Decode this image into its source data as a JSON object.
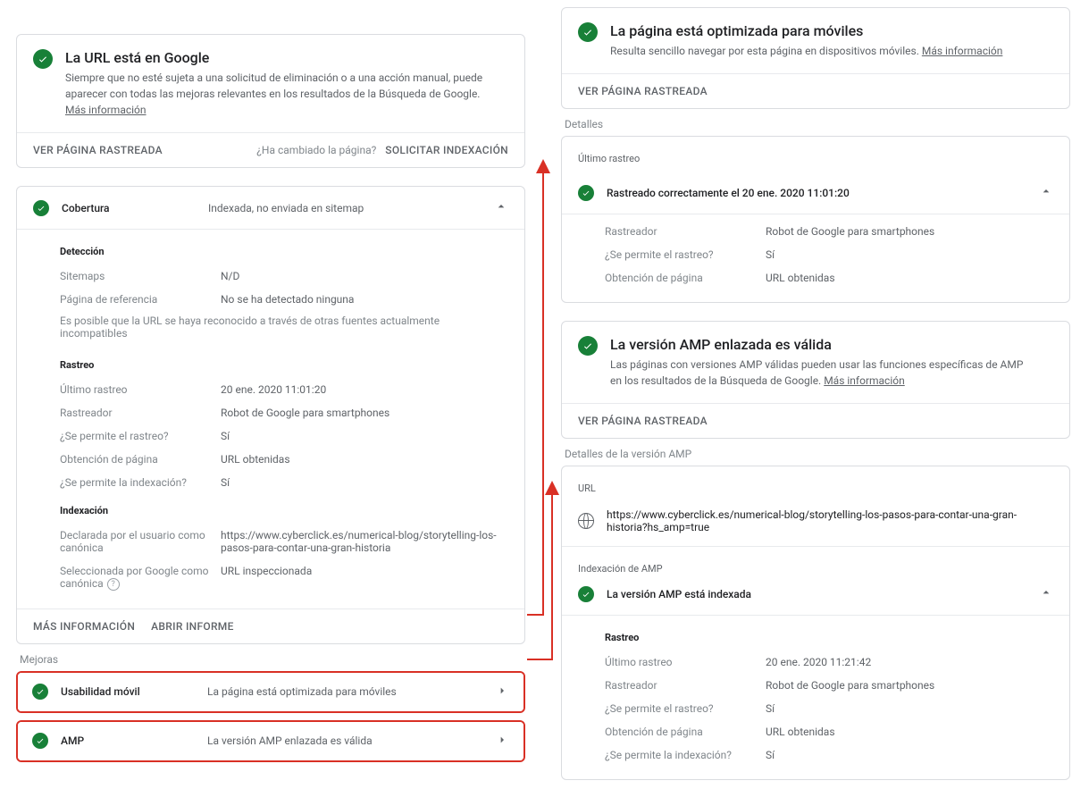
{
  "left": {
    "main": {
      "title": "La URL está en Google",
      "subtitle": "Siempre que no esté sujeta a una solicitud de eliminación o a una acción manual, puede aparecer con todas las mejoras relevantes en los resultados de la Búsqueda de Google.",
      "more_info": "Más información",
      "view_crawled": "VER PÁGINA RASTREADA",
      "changed_q": "¿Ha cambiado la página?",
      "request_index": "SOLICITAR INDEXACIÓN"
    },
    "coverage": {
      "label": "Cobertura",
      "status": "Indexada, no enviada en sitemap",
      "detection_h": "Detección",
      "sitemaps_k": "Sitemaps",
      "sitemaps_v": "N/D",
      "refpage_k": "Página de referencia",
      "refpage_v": "No se ha detectado ninguna",
      "note": "Es posible que la URL se haya reconocido a través de otras fuentes actualmente incompatibles",
      "crawl_h": "Rastreo",
      "lastcrawl_k": "Último rastreo",
      "lastcrawl_v": "20 ene. 2020 11:01:20",
      "crawler_k": "Rastreador",
      "crawler_v": "Robot de Google para smartphones",
      "crawl_allowed_k": "¿Se permite el rastreo?",
      "crawl_allowed_v": "Sí",
      "fetch_k": "Obtención de página",
      "fetch_v": "URL obtenidas",
      "index_allowed_k": "¿Se permite la indexación?",
      "index_allowed_v": "Sí",
      "indexing_h": "Indexación",
      "user_canon_k": "Declarada por el usuario como canónica",
      "user_canon_v": "https://www.cyberclick.es/numerical-blog/storytelling-los-pasos-para-contar-una-gran-historia",
      "google_canon_k": "Seleccionada por Google como canónica",
      "google_canon_v": "URL inspeccionada",
      "more_info": "MÁS INFORMACIÓN",
      "open_report": "ABRIR INFORME"
    },
    "improvements_label": "Mejoras",
    "mobile": {
      "label": "Usabilidad móvil",
      "status": "La página está optimizada para móviles"
    },
    "amp": {
      "label": "AMP",
      "status": "La versión AMP enlazada es válida"
    }
  },
  "right": {
    "mobile": {
      "title": "La página está optimizada para móviles",
      "subtitle": "Resulta sencillo navegar por esta página en dispositivos móviles.",
      "more_info": "Más información",
      "view_crawled": "VER PÁGINA RASTREADA",
      "details_label": "Detalles",
      "lastcrawl_h": "Último rastreo",
      "crawl_status": "Rastreado correctamente el 20 ene. 2020 11:01:20",
      "crawler_k": "Rastreador",
      "crawler_v": "Robot de Google para smartphones",
      "crawl_allowed_k": "¿Se permite el rastreo?",
      "crawl_allowed_v": "Sí",
      "fetch_k": "Obtención de página",
      "fetch_v": "URL obtenidas"
    },
    "amp": {
      "title": "La versión AMP enlazada es válida",
      "subtitle": "Las páginas con versiones AMP válidas pueden usar las funciones específicas de AMP en los resultados de la Búsqueda de Google.",
      "more_info": "Más información",
      "view_crawled": "VER PÁGINA RASTREADA",
      "details_label": "Detalles de la versión AMP",
      "url_h": "URL",
      "url_v": "https://www.cyberclick.es/numerical-blog/storytelling-los-pasos-para-contar-una-gran-historia?hs_amp=true",
      "amp_index_h": "Indexación de AMP",
      "amp_index_status": "La versión AMP está indexada",
      "crawl_h": "Rastreo",
      "lastcrawl_k": "Último rastreo",
      "lastcrawl_v": "20 ene. 2020 11:21:42",
      "crawler_k": "Rastreador",
      "crawler_v": "Robot de Google para smartphones",
      "crawl_allowed_k": "¿Se permite el rastreo?",
      "crawl_allowed_v": "Sí",
      "fetch_k": "Obtención de página",
      "fetch_v": "URL obtenidas",
      "index_allowed_k": "¿Se permite la indexación?",
      "index_allowed_v": "Sí"
    }
  }
}
